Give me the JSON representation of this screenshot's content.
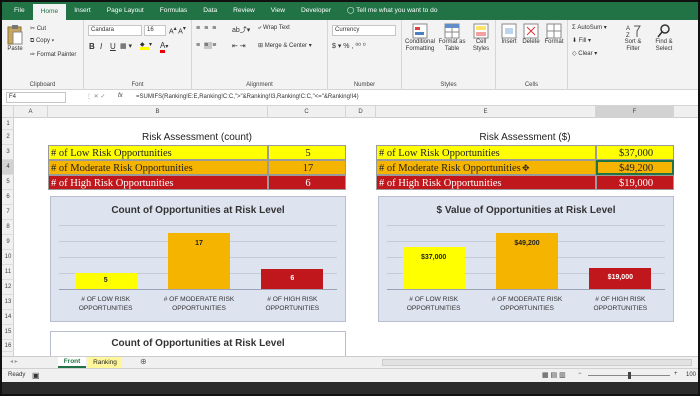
{
  "tabs": [
    "File",
    "Home",
    "Insert",
    "Page Layout",
    "Formulas",
    "Data",
    "Review",
    "View",
    "Developer",
    "Tell me what you want to do"
  ],
  "clipboard": {
    "paste": "Paste",
    "cut": "Cut",
    "copy": "Copy",
    "format_painter": "Format Painter",
    "label": "Clipboard"
  },
  "font": {
    "name": "Candara",
    "size": "16",
    "label": "Font"
  },
  "alignment": {
    "wrap": "Wrap Text",
    "merge": "Merge & Center",
    "label": "Alignment"
  },
  "number": {
    "format": "Currency",
    "label": "Number"
  },
  "styles": {
    "conditional": "Conditional Formatting",
    "format_table": "Format as Table",
    "cell_styles": "Cell Styles",
    "label": "Styles"
  },
  "cells": {
    "insert": "Insert",
    "delete": "Delete",
    "format": "Format",
    "label": "Cells"
  },
  "editing": {
    "autosum": "AutoSum",
    "fill": "Fill",
    "clear": "Clear",
    "sort": "Sort & Filter",
    "find": "Find & Select"
  },
  "formula_bar": {
    "name_box": "F4",
    "fx": "fx",
    "formula": "=SUMIFS(Ranking!E:E,Ranking!C:C,\">\"&Ranking!I3,Ranking!C:C,\"<=\"&Ranking!I4)"
  },
  "columns": [
    "A",
    "B",
    "C",
    "D",
    "E",
    "F"
  ],
  "rows": [
    "1",
    "2",
    "3",
    "4",
    "5",
    "6",
    "7",
    "8",
    "9",
    "10",
    "11",
    "12",
    "13",
    "14",
    "15",
    "16",
    "17",
    "18",
    "19",
    "20"
  ],
  "count_table": {
    "title": "Risk Assessment (count)",
    "rows": [
      {
        "label": "# of Low Risk Opportunities",
        "value": "5"
      },
      {
        "label": "# of Moderate Risk Opportunities",
        "value": "17"
      },
      {
        "label": "# of High Risk Opportunities",
        "value": "6"
      }
    ]
  },
  "value_table": {
    "title": "Risk Assessment ($)",
    "rows": [
      {
        "label": "# of Low Risk Opportunities",
        "value": "$37,000"
      },
      {
        "label": "# of Moderate Risk Opportunities",
        "value": "$49,200"
      },
      {
        "label": "# of High Risk Opportunities",
        "value": "$19,000"
      }
    ]
  },
  "chart_data": [
    {
      "type": "bar",
      "title": "Count of Opportunities at Risk Level",
      "categories": [
        "# OF LOW RISK OPPORTUNITIES",
        "# OF MODERATE RISK OPPORTUNITIES",
        "# OF HIGH RISK OPPORTUNITIES"
      ],
      "values": [
        5,
        17,
        6
      ],
      "labels": [
        "5",
        "17",
        "6"
      ],
      "colors": [
        "#ffff00",
        "#f5b400",
        "#c0171c"
      ]
    },
    {
      "type": "bar",
      "title": "$ Value of Opportunities at Risk Level",
      "categories": [
        "# OF LOW RISK OPPORTUNITIES",
        "# OF MODERATE RISK OPPORTUNITIES",
        "# OF HIGH RISK OPPORTUNITIES"
      ],
      "values": [
        37000,
        49200,
        19000
      ],
      "labels": [
        "$37,000",
        "$49,200",
        "$19,000"
      ],
      "colors": [
        "#ffff00",
        "#f5b400",
        "#c0171c"
      ]
    },
    {
      "type": "bar",
      "title": "Count of Opportunities at Risk Level",
      "categories": [],
      "values": []
    }
  ],
  "sheets": [
    "Front",
    "Ranking"
  ],
  "status": {
    "ready": "Ready",
    "zoom": "100"
  }
}
